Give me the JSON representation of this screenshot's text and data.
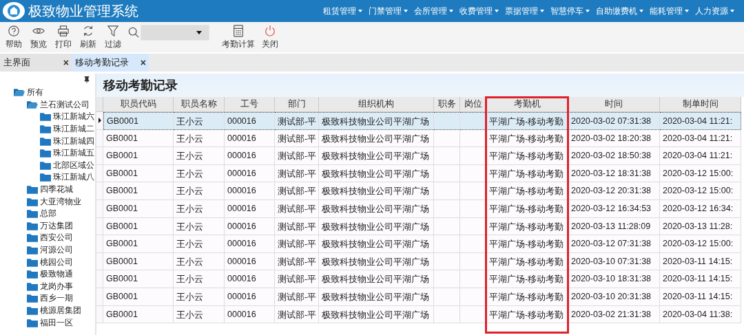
{
  "app_bar": {
    "title": "极致物业管理系统",
    "menus": [
      {
        "label": "租赁管理"
      },
      {
        "label": "门禁管理"
      },
      {
        "label": "会所管理"
      },
      {
        "label": "收费管理"
      },
      {
        "label": "票据管理"
      },
      {
        "label": "智慧停车"
      },
      {
        "label": "自助缴费机"
      },
      {
        "label": "能耗管理"
      },
      {
        "label": "人力资源"
      }
    ]
  },
  "toolbar": {
    "left_buttons": [
      {
        "label": "帮助"
      },
      {
        "label": "预览"
      },
      {
        "label": "打印"
      },
      {
        "label": "刷新"
      },
      {
        "label": "过滤"
      }
    ],
    "right_buttons": [
      {
        "label": "考勤计算"
      },
      {
        "label": "关闭"
      }
    ]
  },
  "tabs": [
    {
      "label": "主界面",
      "selected": false,
      "close": "×"
    },
    {
      "label": "移动考勤记录",
      "selected": true,
      "close": "×"
    }
  ],
  "sidebar": {
    "tree": [
      {
        "label": "所有",
        "expanded": true,
        "children": [
          {
            "label": "兰石测试公司",
            "expanded": true,
            "children": [
              {
                "label": "珠江新城六"
              },
              {
                "label": "珠江新城二"
              },
              {
                "label": "珠江新城四"
              },
              {
                "label": "珠江新城五"
              },
              {
                "label": "北部区域公"
              },
              {
                "label": "珠江新城八"
              }
            ]
          },
          {
            "label": "四季花城"
          },
          {
            "label": "大亚湾物业"
          },
          {
            "label": "总部"
          },
          {
            "label": "万达集团"
          },
          {
            "label": "西安公司"
          },
          {
            "label": "河源公司"
          },
          {
            "label": "桃园公司"
          },
          {
            "label": "极致物通"
          },
          {
            "label": "龙岗办事"
          },
          {
            "label": "西乡一期"
          },
          {
            "label": "桃源居集团"
          },
          {
            "label": "福田一区"
          }
        ]
      }
    ]
  },
  "page_title": "移动考勤记录",
  "table": {
    "columns": [
      {
        "label": "职员代码",
        "highlighted": false
      },
      {
        "label": "职员名称",
        "highlighted": false
      },
      {
        "label": "工号",
        "highlighted": false
      },
      {
        "label": "部门",
        "highlighted": false
      },
      {
        "label": "组织机构",
        "highlighted": false
      },
      {
        "label": "职务",
        "highlighted": false
      },
      {
        "label": "岗位",
        "highlighted": false
      },
      {
        "label": "考勤机",
        "highlighted": true
      },
      {
        "label": "时间",
        "highlighted": false
      },
      {
        "label": "制单时间",
        "highlighted": false
      }
    ],
    "rows": [
      {
        "selected": true,
        "cells": [
          "GB0001",
          "王小云",
          "000016",
          "测试部-平",
          "极致科技物业公司平湖广场",
          "",
          "",
          "平湖广场-移动考勤",
          "2020-03-02 07:31:38",
          "2020-03-04 11:21:"
        ]
      },
      {
        "selected": false,
        "cells": [
          "GB0001",
          "王小云",
          "000016",
          "测试部-平",
          "极致科技物业公司平湖广场",
          "",
          "",
          "平湖广场-移动考勤",
          "2020-03-02 18:20:38",
          "2020-03-04 11:21:"
        ]
      },
      {
        "selected": false,
        "cells": [
          "GB0001",
          "王小云",
          "000016",
          "测试部-平",
          "极致科技物业公司平湖广场",
          "",
          "",
          "平湖广场-移动考勤",
          "2020-03-02 18:50:38",
          "2020-03-04 11:21:"
        ]
      },
      {
        "selected": false,
        "cells": [
          "GB0001",
          "王小云",
          "000016",
          "测试部-平",
          "极致科技物业公司平湖广场",
          "",
          "",
          "平湖广场-移动考勤",
          "2020-03-12 18:31:38",
          "2020-03-12 15:00:"
        ]
      },
      {
        "selected": false,
        "cells": [
          "GB0001",
          "王小云",
          "000016",
          "测试部-平",
          "极致科技物业公司平湖广场",
          "",
          "",
          "平湖广场-移动考勤",
          "2020-03-12 20:31:38",
          "2020-03-12 15:00:"
        ]
      },
      {
        "selected": false,
        "cells": [
          "GB0001",
          "王小云",
          "000016",
          "测试部-平",
          "极致科技物业公司平湖广场",
          "",
          "",
          "平湖广场-移动考勤",
          "2020-03-12 16:34:53",
          "2020-03-12 16:34:"
        ]
      },
      {
        "selected": false,
        "cells": [
          "GB0001",
          "王小云",
          "000016",
          "测试部-平",
          "极致科技物业公司平湖广场",
          "",
          "",
          "平湖广场-移动考勤",
          "2020-03-13 11:28:09",
          "2020-03-13 11:28:"
        ]
      },
      {
        "selected": false,
        "cells": [
          "GB0001",
          "王小云",
          "000016",
          "测试部-平",
          "极致科技物业公司平湖广场",
          "",
          "",
          "平湖广场-移动考勤",
          "2020-03-12 07:31:38",
          "2020-03-12 15:00:"
        ]
      },
      {
        "selected": false,
        "cells": [
          "GB0001",
          "王小云",
          "000016",
          "测试部-平",
          "极致科技物业公司平湖广场",
          "",
          "",
          "平湖广场-移动考勤",
          "2020-03-10 07:31:38",
          "2020-03-11 14:15:"
        ]
      },
      {
        "selected": false,
        "cells": [
          "GB0001",
          "王小云",
          "000016",
          "测试部-平",
          "极致科技物业公司平湖广场",
          "",
          "",
          "平湖广场-移动考勤",
          "2020-03-10 18:31:38",
          "2020-03-11 14:15:"
        ]
      },
      {
        "selected": false,
        "cells": [
          "GB0001",
          "王小云",
          "000016",
          "测试部-平",
          "极致科技物业公司平湖广场",
          "",
          "",
          "平湖广场-移动考勤",
          "2020-03-10 20:31:38",
          "2020-03-11 14:15:"
        ]
      },
      {
        "selected": false,
        "cells": [
          "GB0001",
          "王小云",
          "000016",
          "测试部-平",
          "极致科技物业公司平湖广场",
          "",
          "",
          "平湖广场-移动考勤",
          "2020-03-02 21:31:38",
          "2020-03-04 11:38:"
        ]
      }
    ]
  }
}
